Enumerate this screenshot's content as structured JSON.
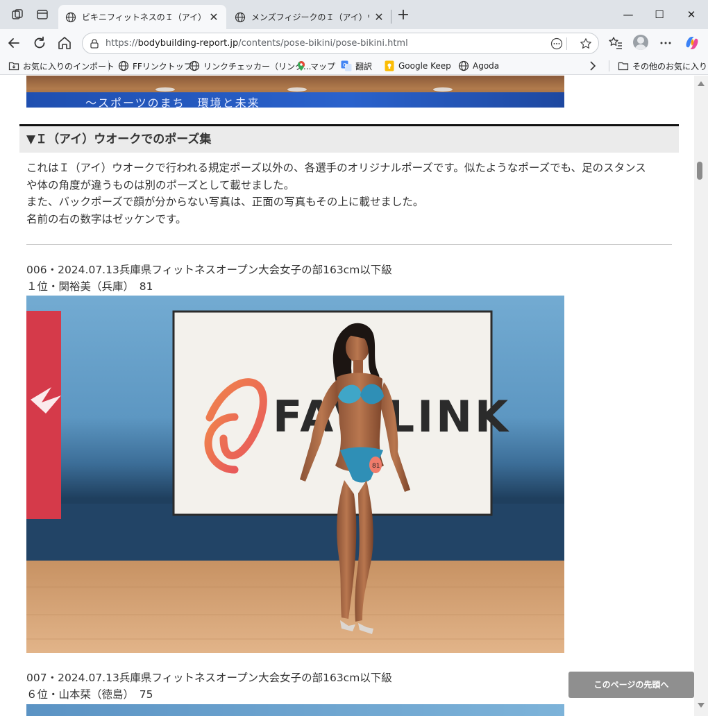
{
  "browser": {
    "tabs": [
      {
        "title": "ビキニフィットネスのＩ（アイ）ウオークに",
        "active": true
      },
      {
        "title": "メンズフィジークのＩ（アイ）ウオークにお",
        "active": false
      }
    ],
    "url_scheme": "https://",
    "url_host": "bodybuilding-report.jp",
    "url_path": "/contents/pose-bikini/pose-bikini.html",
    "bookmarks": [
      {
        "label": "お気に入りのインポート",
        "icon": "import-folder-icon"
      },
      {
        "label": "FFリンクトップ",
        "icon": "globe-icon"
      },
      {
        "label": "リンクチェッカー（リンク...",
        "icon": "globe-icon"
      },
      {
        "label": "マップ",
        "icon": "map-pin-icon"
      },
      {
        "label": "翻訳",
        "icon": "translate-icon"
      },
      {
        "label": "Google Keep",
        "icon": "keep-icon"
      },
      {
        "label": "Agoda",
        "icon": "globe-icon"
      }
    ],
    "other_favorites": "その他のお気に入り"
  },
  "top_photo": {
    "banner_text": "〜スポーツのまち　環境と未来"
  },
  "section": {
    "heading": "▼Ｉ（アイ）ウオークでのポーズ集",
    "intro": [
      "これはＩ（アイ）ウオークで行われる規定ポーズ以外の、各選手のオリジナルポーズです。似たようなポーズでも、足のスタンス",
      "や体の角度が違うものは別のポーズとして載せました。",
      "また、バックポーズで顔が分からない写真は、正面の写真もその上に載せました。",
      "名前の右の数字はゼッケンです。"
    ]
  },
  "entries": [
    {
      "line1": "006・2024.07.13兵庫県フィットネスオープン大会女子の部163cm以下級",
      "line2": "１位・関裕美（兵庫）　81",
      "photo_sign_text": "FAV LINK",
      "bib": "81"
    },
    {
      "line1": "007・2024.07.13兵庫県フィットネスオープン大会女子の部163cm以下級",
      "line2": "６位・山本栞（徳島）　75"
    }
  ],
  "to_top_button": "このページの先頭へ",
  "colors": {
    "tabstrip": "#dfe3e8",
    "toolbar": "#f7f8fa",
    "section_bg": "#ebebeb",
    "to_top_bg": "#8f8f8f"
  }
}
